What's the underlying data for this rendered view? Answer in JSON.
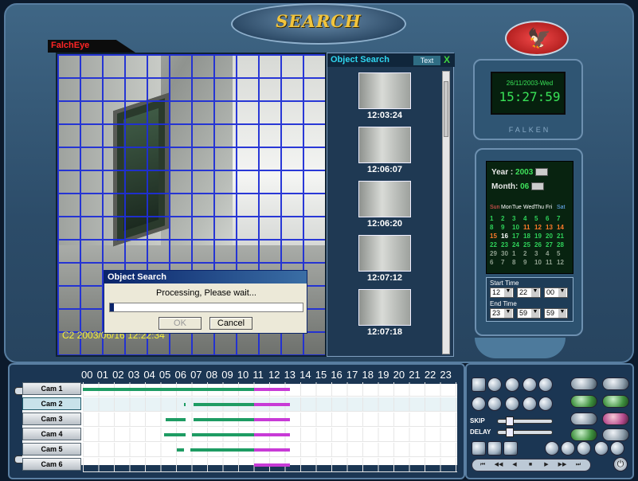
{
  "window": {
    "title": "SEARCH",
    "brand": "FalchEye"
  },
  "video": {
    "overlay_text": "C2 2003/06/16 12:22:34"
  },
  "dialog": {
    "title": "Object Search",
    "message": "Processing, Please wait...",
    "progress": 0.02,
    "ok_label": "OK",
    "cancel_label": "Cancel"
  },
  "object_search": {
    "title": "Object Search",
    "text_button": "Text",
    "close_label": "X",
    "thumbnails": [
      {
        "time": "12:03:24"
      },
      {
        "time": "12:06:07"
      },
      {
        "time": "12:06:20"
      },
      {
        "time": "12:07:12"
      },
      {
        "time": "12:07:18"
      }
    ]
  },
  "clock": {
    "date": "26/11/2003-Wed",
    "time": "15:27:59",
    "brand": "FALKEN"
  },
  "calendar": {
    "year_label": "Year :",
    "year": "2003",
    "month_label": "Month:",
    "month": "06",
    "day_headers": [
      "Sun",
      "Mon",
      "Tue",
      "Wed",
      "Thu",
      "Fri",
      "Sat"
    ],
    "weeks": [
      [
        "1",
        "2",
        "3",
        "4",
        "5",
        "6",
        "7"
      ],
      [
        "8",
        "9",
        "10",
        "11",
        "12",
        "13",
        "14"
      ],
      [
        "15",
        "16",
        "17",
        "18",
        "19",
        "20",
        "21"
      ],
      [
        "22",
        "23",
        "24",
        "25",
        "26",
        "27",
        "28"
      ],
      [
        "29",
        "30",
        "1",
        "2",
        "3",
        "4",
        "5"
      ],
      [
        "6",
        "7",
        "8",
        "9",
        "10",
        "11",
        "12"
      ]
    ],
    "start_label": "Start Time",
    "start": [
      "12",
      "22",
      "00"
    ],
    "end_label": "End Time",
    "end": [
      "23",
      "59",
      "59"
    ]
  },
  "timeline": {
    "hours": [
      "00",
      "01",
      "02",
      "03",
      "04",
      "05",
      "06",
      "07",
      "08",
      "09",
      "10",
      "11",
      "12",
      "13",
      "14",
      "15",
      "16",
      "17",
      "18",
      "19",
      "20",
      "21",
      "22",
      "23"
    ],
    "cameras": [
      {
        "label": "Cam 1",
        "selected": false
      },
      {
        "label": "Cam 2",
        "selected": true
      },
      {
        "label": "Cam 3",
        "selected": false
      },
      {
        "label": "Cam 4",
        "selected": false
      },
      {
        "label": "Cam 5",
        "selected": false
      },
      {
        "label": "Cam 6",
        "selected": false
      }
    ]
  },
  "controls": {
    "skip_label": "SKIP",
    "delay_label": "DELAY"
  },
  "colors": {
    "grid": "#1f2fd6",
    "recording": "#1e9c63",
    "event": "#c83ad6",
    "lcd": "#39e257"
  }
}
